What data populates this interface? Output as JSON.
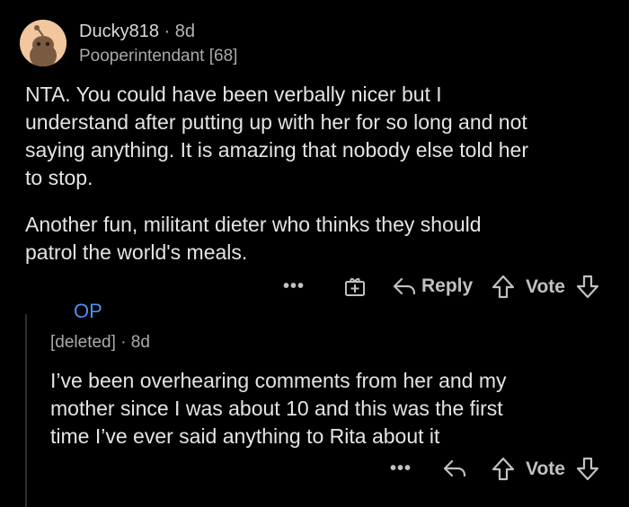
{
  "comment": {
    "username": "Ducky818",
    "separator": "·",
    "age": "8d",
    "flair": "Pooperintendant [68]",
    "paragraph1": [
      "NTA.  You could have been verbally nicer but I",
      "understand after putting up with her for so long and not",
      "saying anything.  It is amazing that nobody else told her",
      "to stop."
    ],
    "paragraph2": [
      "Another fun, militant dieter who thinks they should",
      "patrol the world's meals."
    ],
    "actions": {
      "more": "•••",
      "reply_label": "Reply",
      "vote_label": "Vote"
    }
  },
  "reply": {
    "op_badge": "OP",
    "username": "[deleted]",
    "separator": "·",
    "age": "8d",
    "lines": [
      "I’ve been overhearing comments from her and my",
      "mother since I was about 10 and this was the first",
      "time I’ve ever said anything to Rita about it"
    ],
    "actions": {
      "more": "•••",
      "vote_label": "Vote"
    }
  },
  "icons": [
    "avatar-snoo",
    "gift-icon",
    "reply-arrow-icon",
    "upvote-icon",
    "downvote-icon"
  ]
}
